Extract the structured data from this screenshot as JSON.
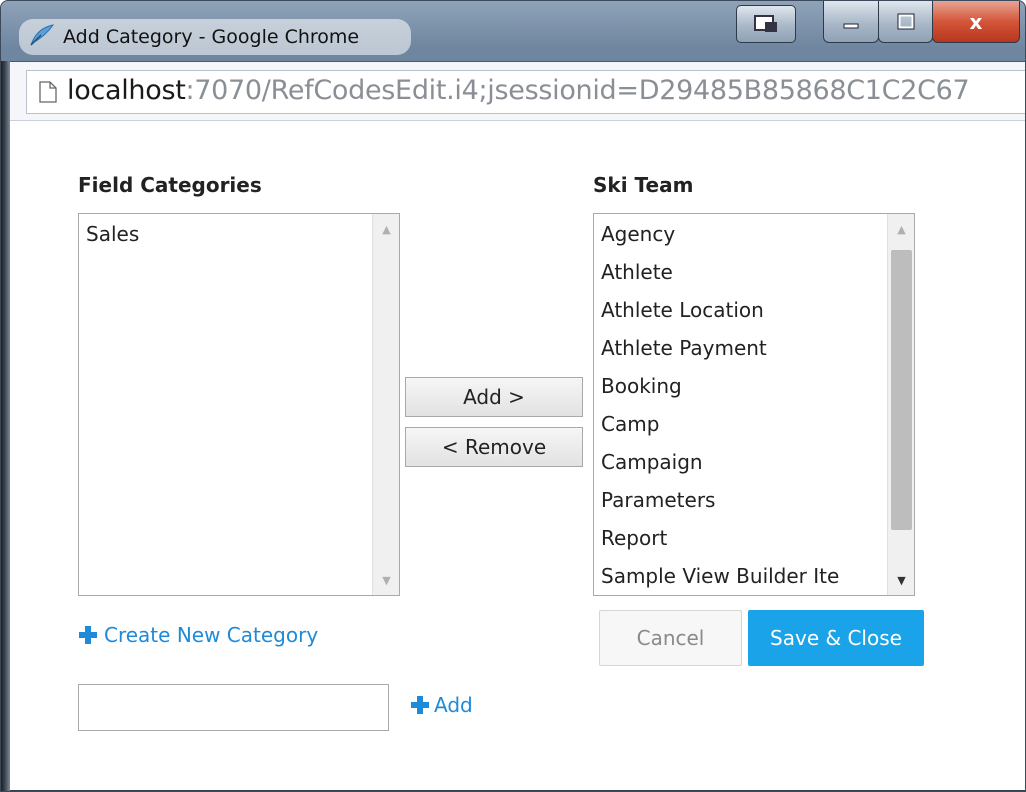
{
  "window": {
    "title": "Add Category - Google Chrome",
    "app_icon": "chrome-feather-icon",
    "controls": {
      "dock_icon": "dock-icon",
      "minimize_icon": "minimize-icon",
      "maximize_icon": "maximize-icon",
      "close_label": "x"
    }
  },
  "address_bar": {
    "page_icon": "page-icon",
    "url_host": "localhost",
    "url_rest": ":7070/RefCodesEdit.i4;jsessionid=D29485B85868C1C2C67"
  },
  "field_categories": {
    "label": "Field Categories",
    "items": [
      "Sales"
    ]
  },
  "ski_team": {
    "label": "Ski Team",
    "items": [
      "Agency",
      "Athlete",
      "Athlete Location",
      "Athlete Payment",
      "Booking",
      "Camp",
      "Campaign",
      "Parameters",
      "Report",
      "Sample View Builder Ite"
    ]
  },
  "transfer": {
    "add_label": "Add >",
    "remove_label": "< Remove"
  },
  "create_new": {
    "icon": "plus-icon",
    "label": "Create New Category"
  },
  "new_category_input": {
    "value": "",
    "add_label": "Add"
  },
  "actions": {
    "cancel_label": "Cancel",
    "save_label": "Save & Close"
  },
  "colors": {
    "accent": "#1aa3e8",
    "link": "#1f8ad8"
  }
}
